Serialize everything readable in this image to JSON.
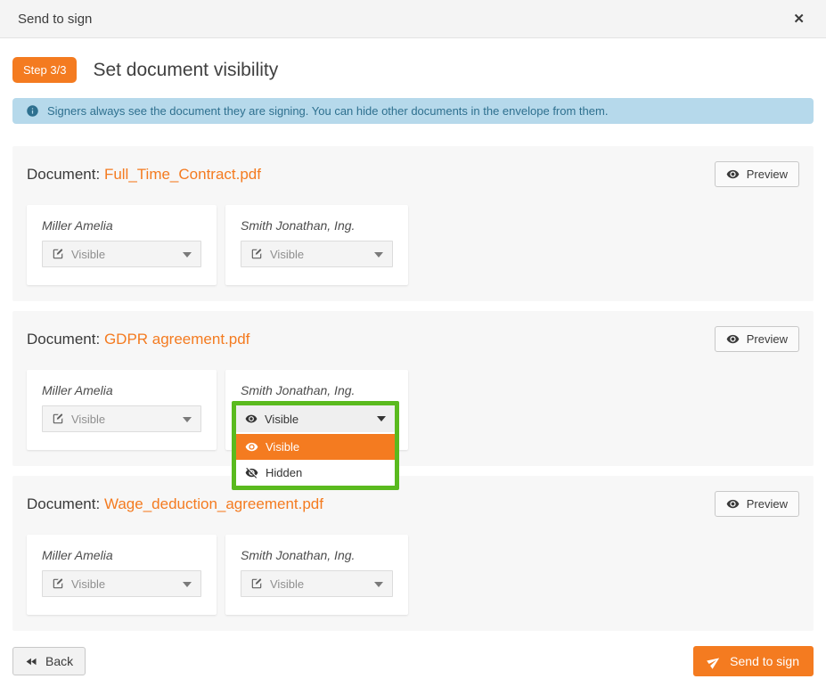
{
  "modal": {
    "title": "Send to sign",
    "close_icon": "✕"
  },
  "wizard": {
    "step_badge": "Step 3/3",
    "heading": "Set document visibility"
  },
  "banner": {
    "text": "Signers always see the document they are signing. You can hide other documents in the envelope from them."
  },
  "labels": {
    "document": "Document:",
    "preview": "Preview"
  },
  "documents": [
    {
      "filename": "Full_Time_Contract.pdf",
      "signers": [
        {
          "name": "Miller Amelia",
          "value": "Visible"
        },
        {
          "name": "Smith Jonathan, Ing.",
          "value": "Visible"
        }
      ]
    },
    {
      "filename": "GDPR agreement.pdf",
      "signers": [
        {
          "name": "Miller Amelia",
          "value": "Visible"
        },
        {
          "name": "Smith Jonathan, Ing.",
          "value": "Visible",
          "dropdown_open": true,
          "options": [
            {
              "label": "Visible",
              "selected": true
            },
            {
              "label": "Hidden",
              "selected": false
            }
          ]
        }
      ]
    },
    {
      "filename": "Wage_deduction_agreement.pdf",
      "signers": [
        {
          "name": "Miller Amelia",
          "value": "Visible"
        },
        {
          "name": "Smith Jonathan, Ing.",
          "value": "Visible"
        }
      ]
    }
  ],
  "footer": {
    "back": "Back",
    "send": "Send to sign"
  },
  "colors": {
    "accent_orange": "#f47b20",
    "highlight_green": "#5aba1e",
    "info_bg": "#b6d9eb",
    "info_text": "#2e708f"
  }
}
